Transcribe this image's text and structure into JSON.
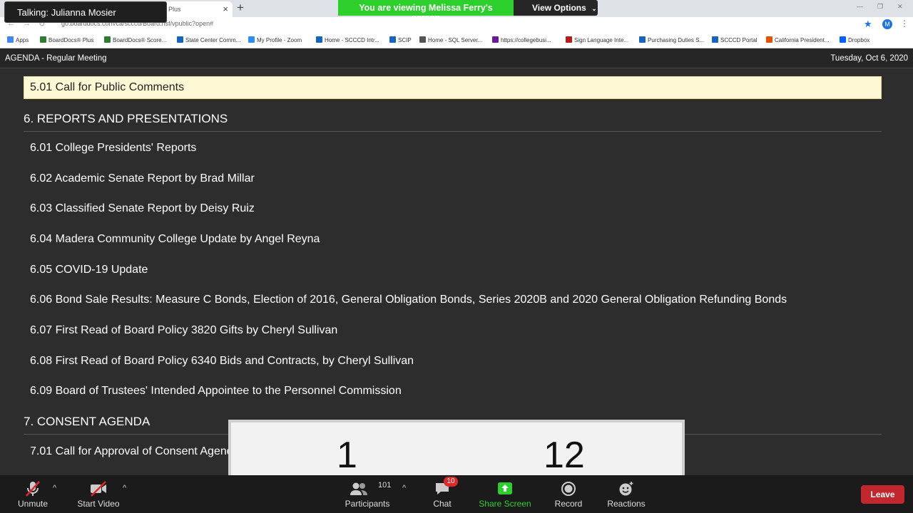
{
  "browser": {
    "tab_title": "Plus",
    "url": "go.boarddocs.com/ca/scccd/Board.nsf/vpublic?open#",
    "bookmarks": [
      {
        "label": "Apps",
        "color": "#4285f4"
      },
      {
        "label": "BoardDocs® Plus",
        "color": "#2e7d32"
      },
      {
        "label": "BoardDocs® Score...",
        "color": "#2e7d32"
      },
      {
        "label": "State Center Comm...",
        "color": "#1565c0"
      },
      {
        "label": "My Profile - Zoom",
        "color": "#2d8cff"
      },
      {
        "label": "Home - SCCCD Intr...",
        "color": "#1565c0"
      },
      {
        "label": "SCIP",
        "color": "#1565c0"
      },
      {
        "label": "Home - SQL Server...",
        "color": "#555555"
      },
      {
        "label": "https://collegebusi...",
        "color": "#6a1b9a"
      },
      {
        "label": "Sign Language Inte...",
        "color": "#b71c1c"
      },
      {
        "label": "Purchasing Duties S...",
        "color": "#1565c0"
      },
      {
        "label": "SCCCD Portal",
        "color": "#1565c0"
      },
      {
        "label": "California President...",
        "color": "#e65100"
      },
      {
        "label": "Dropbox",
        "color": "#0061ff"
      }
    ],
    "profile_initial": "M"
  },
  "zoom": {
    "talking": "Talking: Julianna Mosier",
    "viewing_banner": "You are viewing Melissa Ferry's screen",
    "view_options": "View Options",
    "gallery_numbers": [
      "1",
      "12"
    ],
    "toolbar": {
      "unmute": "Unmute",
      "start_video": "Start Video",
      "participants": "Participants",
      "participants_count": "101",
      "chat": "Chat",
      "chat_badge": "10",
      "share_screen": "Share Screen",
      "record": "Record",
      "reactions": "Reactions",
      "leave": "Leave"
    }
  },
  "agenda": {
    "header_left": "AGENDA - Regular Meeting",
    "header_right": "Tuesday, Oct 6, 2020",
    "highlighted_item": "5.01 Call for Public Comments",
    "section6": "6. REPORTS AND PRESENTATIONS",
    "items6": [
      "6.01 College Presidents' Reports",
      "6.02 Academic Senate Report by Brad Millar",
      "6.03 Classified Senate Report by Deisy Ruiz",
      "6.04 Madera Community College Update by Angel Reyna",
      "6.05 COVID-19 Update",
      "6.06 Bond Sale Results: Measure C Bonds, Election of 2016, General Obligation Bonds, Series 2020B and 2020 General Obligation Refunding Bonds",
      "6.07 First Read of Board Policy 3820 Gifts by Cheryl Sullivan",
      "6.08 First Read of Board Policy 6340 Bids and Contracts, by Cheryl Sullivan",
      "6.09 Board of Trustees' Intended Appointee to the Personnel Commission"
    ],
    "section7": "7. CONSENT AGENDA",
    "item7_01": "7.01 Call for Approval of Consent Agenda"
  }
}
